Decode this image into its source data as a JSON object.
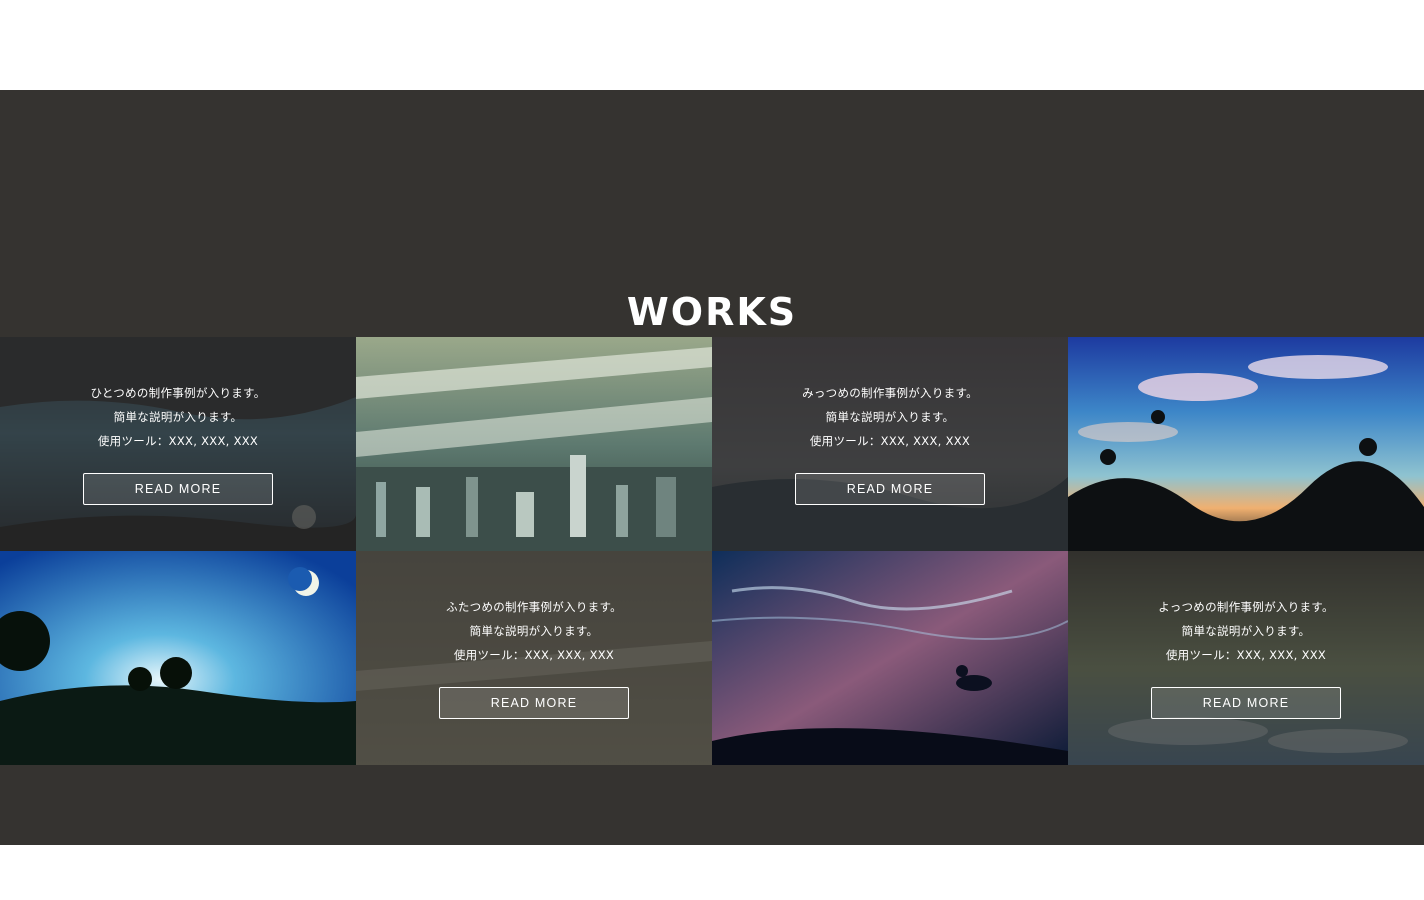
{
  "section": {
    "title": "WORKS"
  },
  "works": [
    {
      "line1": "ひとつめの制作事例が入ります。",
      "line2": "簡単な説明が入ります。",
      "line3": "使用ツール：XXX, XXX, XXX",
      "button": "READ MORE"
    },
    {
      "line1": "ふたつめの制作事例が入ります。",
      "line2": "簡単な説明が入ります。",
      "line3": "使用ツール：XXX, XXX, XXX",
      "button": "READ MORE"
    },
    {
      "line1": "みっつめの制作事例が入ります。",
      "line2": "簡単な説明が入ります。",
      "line3": "使用ツール：XXX, XXX, XXX",
      "button": "READ MORE"
    },
    {
      "line1": "よっつめの制作事例が入ります。",
      "line2": "簡単な説明が入ります。",
      "line3": "使用ツール：XXX, XXX, XXX",
      "button": "READ MORE"
    }
  ],
  "colors": {
    "section_bg": "#353330",
    "text": "#ffffff"
  }
}
